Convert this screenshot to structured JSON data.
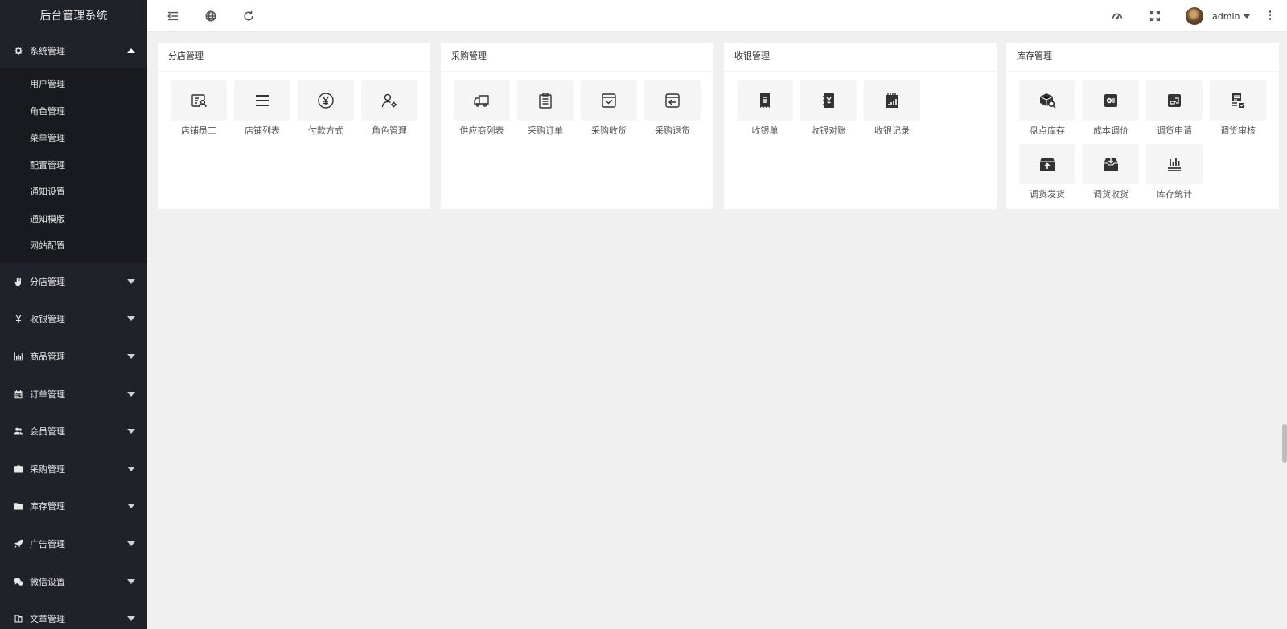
{
  "app": {
    "title": "后台管理系统"
  },
  "sidebar": {
    "system": {
      "label": "系统管理",
      "icon": "gear-icon",
      "items": [
        "用户管理",
        "角色管理",
        "菜单管理",
        "配置管理",
        "通知设置",
        "通知模版",
        "网站配置"
      ]
    },
    "groups": [
      {
        "label": "分店管理",
        "icon": "hand-icon"
      },
      {
        "label": "收银管理",
        "icon": "yen-icon"
      },
      {
        "label": "商品管理",
        "icon": "bar-chart-icon"
      },
      {
        "label": "订单管理",
        "icon": "calendar-icon"
      },
      {
        "label": "会员管理",
        "icon": "users-icon"
      },
      {
        "label": "采购管理",
        "icon": "briefcase-icon"
      },
      {
        "label": "库存管理",
        "icon": "folder-icon"
      },
      {
        "label": "广告管理",
        "icon": "rocket-icon"
      },
      {
        "label": "微信设置",
        "icon": "wechat-icon"
      },
      {
        "label": "文章管理",
        "icon": "article-icon"
      }
    ]
  },
  "header": {
    "icons": [
      "menu-toggle-icon",
      "globe-icon",
      "refresh-icon",
      "theme-icon",
      "fullscreen-icon"
    ],
    "user": {
      "name": "admin"
    }
  },
  "panels": [
    {
      "title": "分店管理",
      "tiles": [
        {
          "label": "店铺员工",
          "icon": "staff-card-icon"
        },
        {
          "label": "店铺列表",
          "icon": "list-icon"
        },
        {
          "label": "付款方式",
          "icon": "yen-circle-icon"
        },
        {
          "label": "角色管理",
          "icon": "user-settings-icon"
        }
      ]
    },
    {
      "title": "采购管理",
      "tiles": [
        {
          "label": "供应商列表",
          "icon": "truck-icon"
        },
        {
          "label": "采购订单",
          "icon": "clipboard-icon"
        },
        {
          "label": "采购收货",
          "icon": "box-check-icon"
        },
        {
          "label": "采购退货",
          "icon": "box-return-icon"
        }
      ]
    },
    {
      "title": "收银管理",
      "tiles": [
        {
          "label": "收银单",
          "icon": "receipt-icon"
        },
        {
          "label": "收银对账",
          "icon": "ledger-yen-icon"
        },
        {
          "label": "收银记录",
          "icon": "record-chart-icon"
        }
      ]
    },
    {
      "title": "库存管理",
      "tiles": [
        {
          "label": "盘点库存",
          "icon": "box-search-icon"
        },
        {
          "label": "成本调价",
          "icon": "price-tag-icon"
        },
        {
          "label": "调货申请",
          "icon": "transfer-request-icon"
        },
        {
          "label": "调货审核",
          "icon": "audit-icon"
        },
        {
          "label": "调货发货",
          "icon": "ship-out-icon"
        },
        {
          "label": "调货收货",
          "icon": "receive-icon"
        },
        {
          "label": "库存统计",
          "icon": "stats-icon"
        }
      ]
    }
  ]
}
